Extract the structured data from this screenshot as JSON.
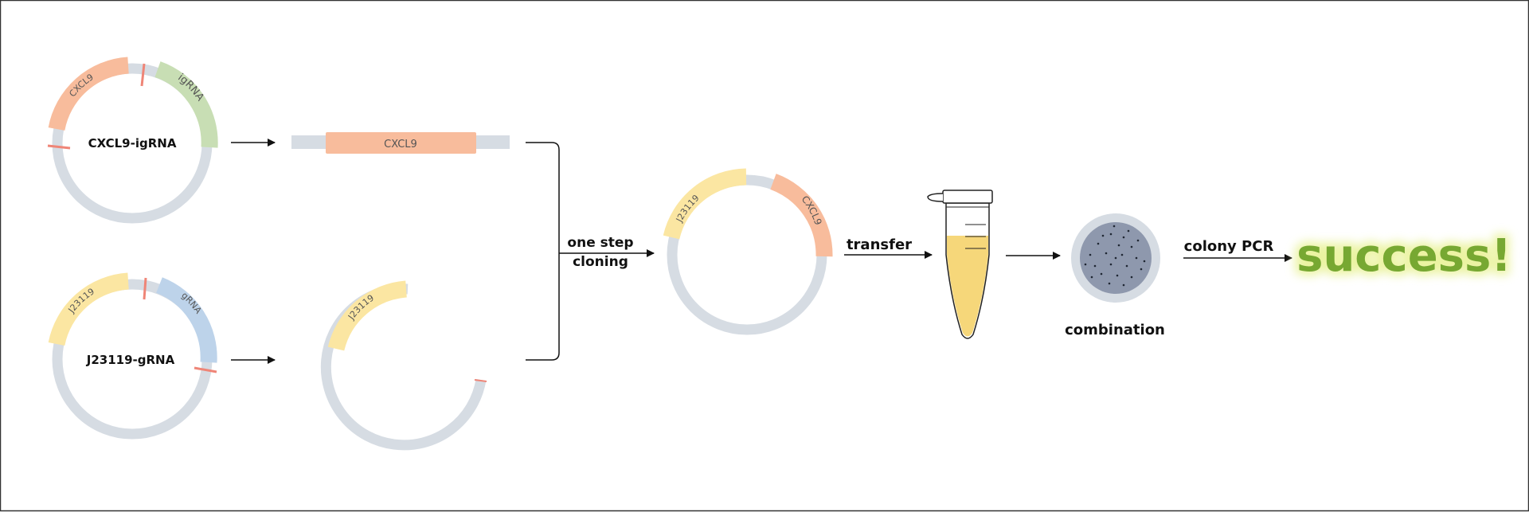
{
  "plasmid_top": {
    "name": "CXCL9-igRNA",
    "segment_a": "CXCL9",
    "segment_b": "igRNA"
  },
  "plasmid_bottom": {
    "name": "J23119-gRNA",
    "segment_a": "J23119",
    "segment_b": "gRNA"
  },
  "fragment_insert": {
    "label": "CXCL9"
  },
  "fragment_backbone": {
    "label": "J23119"
  },
  "step_cloning": {
    "line1": "one step",
    "line2": "cloning"
  },
  "product_plasmid": {
    "segment_a": "J23119",
    "segment_b": "CXCL9"
  },
  "step_transfer": {
    "label": "transfer"
  },
  "plate": {
    "label": "combination"
  },
  "step_pcr": {
    "label": "colony PCR"
  },
  "result": {
    "label": "success!"
  },
  "colors": {
    "backbone": "#d6dce3",
    "cxcl9": "#f8bc9c",
    "igrna": "#c8deb4",
    "j23119": "#fbe6a2",
    "grna": "#bdd3ea",
    "cut_site": "#ef8577",
    "tube_liquid": "#f6d77a",
    "plate_agar": "#8e98ad",
    "plate_rim": "#d6dce3",
    "success_text": "#77a832",
    "success_glow": "#e9f299"
  }
}
